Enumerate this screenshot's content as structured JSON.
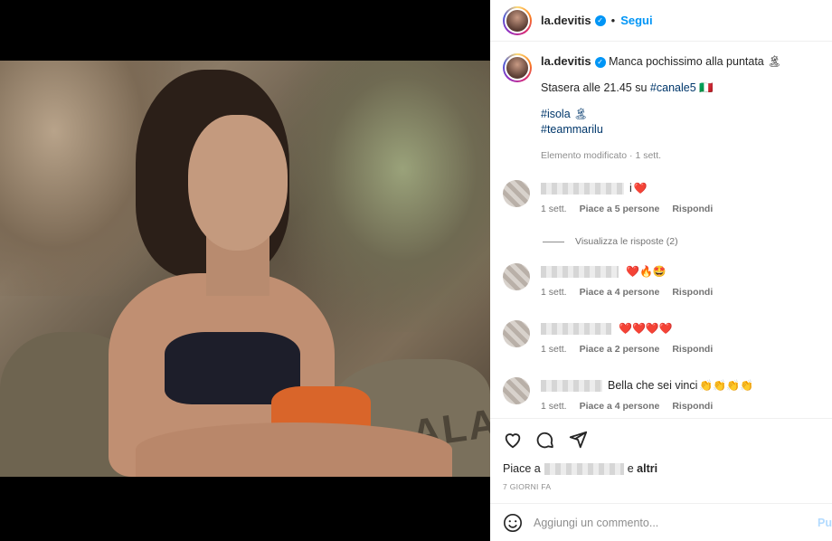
{
  "post": {
    "username": "la.devitis",
    "follow_label": "Segui",
    "dot": "•"
  },
  "caption": {
    "username": "la.devitis",
    "text": "Manca pochissimo alla puntata 🏝",
    "line2_prefix": "Stasera alle 21.45 su ",
    "line2_tag": "#canale5",
    "line2_suffix": " 🇮🇹",
    "tag1": "#isola 🏝",
    "tag2": "#teammarilu",
    "meta": "Elemento modificato · 1 sett."
  },
  "comments": [
    {
      "text_tail": "i",
      "emoji": "❤️",
      "time": "1 sett.",
      "likes": "Piace a 5 persone",
      "reply": "Rispondi"
    },
    {
      "text_tail": "",
      "emoji": "❤️🔥🤩",
      "time": "1 sett.",
      "likes": "Piace a 4 persone",
      "reply": "Rispondi"
    },
    {
      "text_tail": "",
      "emoji": "❤️❤️❤️❤️",
      "time": "1 sett.",
      "likes": "Piace a 2 persone",
      "reply": "Rispondi"
    },
    {
      "text_tail": "Bella che sei vinci",
      "emoji": "👏👏👏👏",
      "time": "1 sett.",
      "likes": "Piace a 4 persone",
      "reply": "Rispondi"
    }
  ],
  "view_replies": "Visualizza le risposte (2)",
  "likes_prefix": "Piace a",
  "likes_suffix": "e",
  "likes_others": "altri",
  "date": "7 GIORNI FA",
  "add_comment_placeholder": "Aggiungi un commento...",
  "publish_label": "Pu",
  "photo_text": "ALAU",
  "colors": {
    "accent": "#0095f6",
    "link": "#00376b",
    "muted": "#8e8e8e"
  }
}
